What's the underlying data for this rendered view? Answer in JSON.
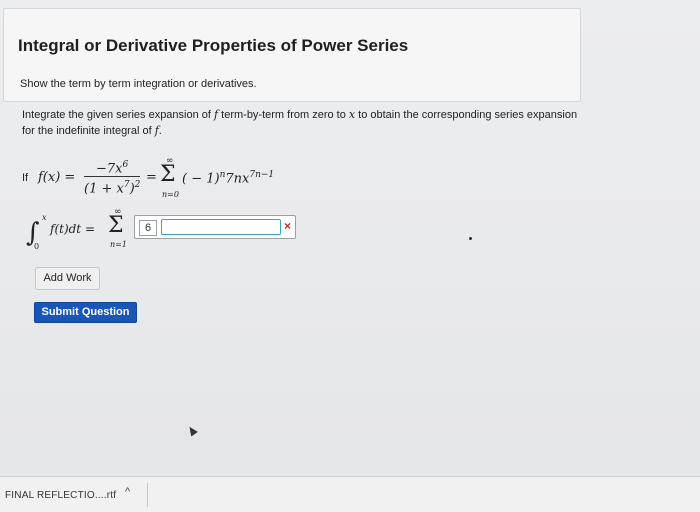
{
  "header": {
    "title": "Integral or Derivative Properties of Power Series",
    "subtitle": "Show the term by term integration or derivatives."
  },
  "instructions": {
    "part1": "Integrate the given series expansion of ",
    "f1": "f",
    "part2": " term-by-term from zero to ",
    "x": "x",
    "part3": " to obtain the corresponding series expansion for the indefinite integral of ",
    "f2": "f",
    "part4": "."
  },
  "equation1": {
    "if_text": "If",
    "lhs": "f(x) =",
    "numerator": "−7x",
    "numerator_exp": "6",
    "denominator": "(1 + x",
    "denominator_exp_inner": "7",
    "denominator_close": ")",
    "denominator_exp_outer": "2",
    "equals": "=",
    "sum_top": "∞",
    "sum_symbol": "Σ",
    "sum_bottom": "n=0",
    "term_main": "( − 1)",
    "term_exp1": "n",
    "term_mid": "7nx",
    "term_exp2": "7n−1"
  },
  "equation2": {
    "integral": "∫",
    "upper": "x",
    "lower": "0",
    "integrand": "f(t)dt =",
    "sum_top": "∞",
    "sum_symbol": "Σ",
    "sum_bottom": "n=1"
  },
  "answer": {
    "box_value": "6",
    "input_value": "",
    "clear_icon": "×"
  },
  "buttons": {
    "add_work": "Add Work",
    "submit": "Submit Question"
  },
  "download_bar": {
    "filename": "FINAL REFLECTIO....rtf",
    "chevron": "^"
  }
}
